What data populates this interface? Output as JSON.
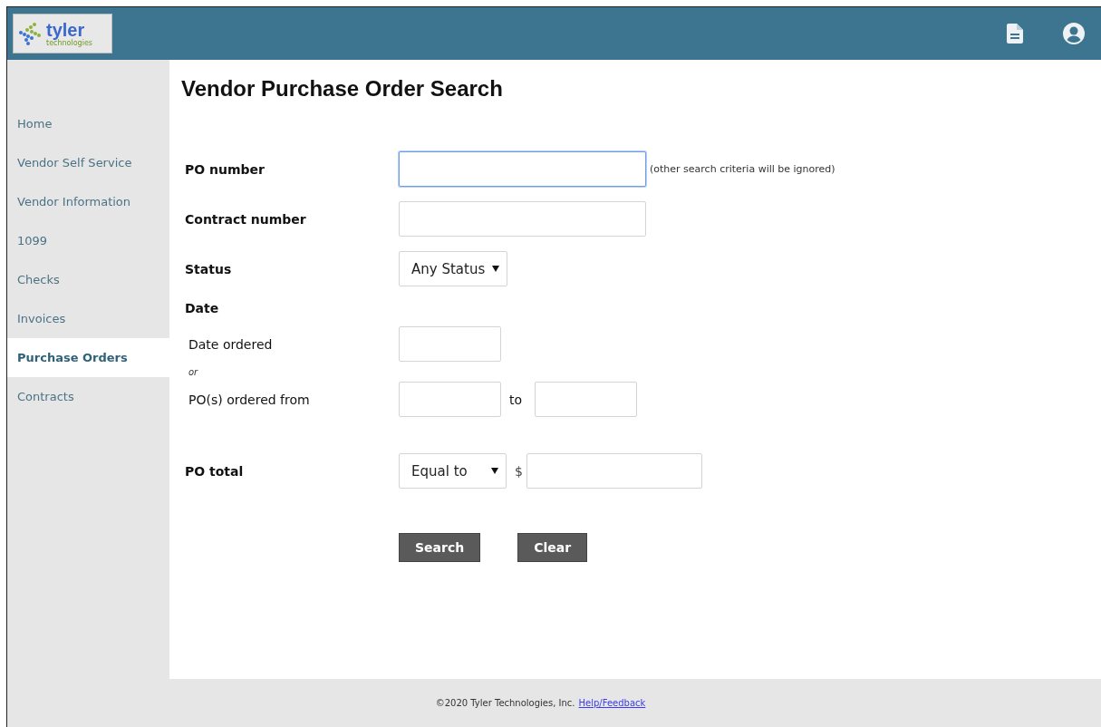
{
  "header": {
    "logo": {
      "name": "tyler",
      "tagline": "technologies"
    }
  },
  "sidebar": {
    "items": [
      {
        "label": "Home",
        "selected": false
      },
      {
        "label": "Vendor Self Service",
        "selected": false
      },
      {
        "label": "Vendor Information",
        "selected": false
      },
      {
        "label": "1099",
        "selected": false
      },
      {
        "label": "Checks",
        "selected": false
      },
      {
        "label": "Invoices",
        "selected": false
      },
      {
        "label": "Purchase Orders",
        "selected": true
      },
      {
        "label": "Contracts",
        "selected": false
      }
    ]
  },
  "page": {
    "title": "Vendor Purchase Order Search"
  },
  "form": {
    "rows": [
      {
        "kind": "text",
        "label": "PO number",
        "focused": true,
        "note": "(other search criteria will be ignored)"
      },
      {
        "kind": "text",
        "label": "Contract number",
        "focused": false
      },
      {
        "kind": "select",
        "label": "Status",
        "value": "Any Status"
      },
      {
        "kind": "heading",
        "label": "Date"
      },
      {
        "kind": "date",
        "label": "Date ordered"
      },
      {
        "kind": "or",
        "label": "or"
      },
      {
        "kind": "range",
        "label": "PO(s) ordered from",
        "joiner": "to"
      },
      {
        "kind": "amount",
        "label": "PO total",
        "value": "Equal to",
        "currency": "$"
      }
    ],
    "buttons": [
      "Search",
      "Clear"
    ]
  },
  "footer": {
    "copyright": "©2020 Tyler Technologies, Inc.",
    "link": "Help/Feedback"
  }
}
